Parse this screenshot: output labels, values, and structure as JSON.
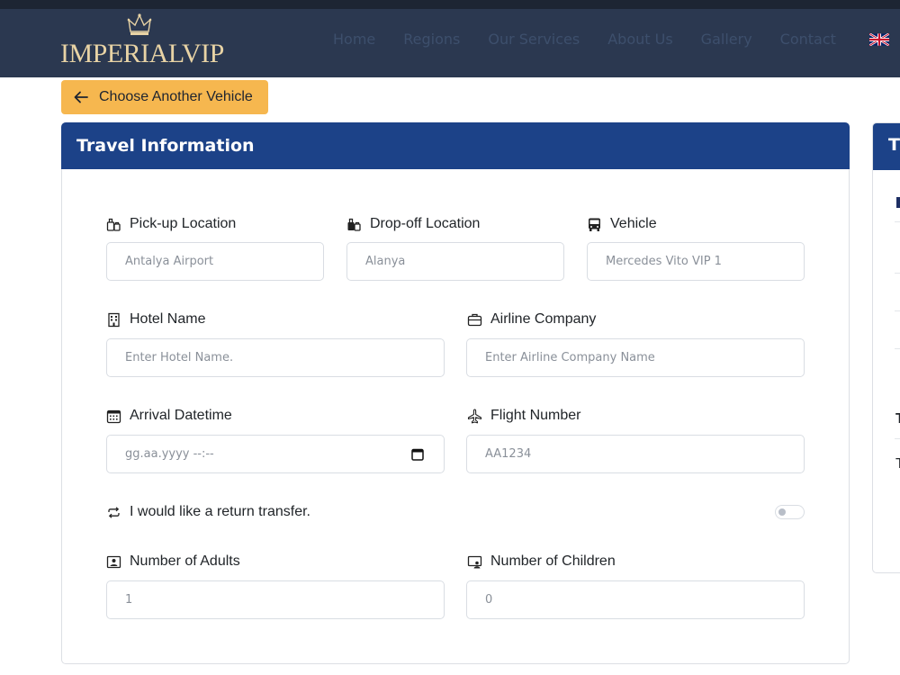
{
  "brand": {
    "name_part1": "IMPERIAL",
    "name_part2": "VIP"
  },
  "nav": {
    "items": [
      {
        "label": "Home"
      },
      {
        "label": "Regions"
      },
      {
        "label": "Our Services"
      },
      {
        "label": "About Us"
      },
      {
        "label": "Gallery"
      },
      {
        "label": "Contact"
      }
    ],
    "language_flag": "uk-flag-icon"
  },
  "back_button": {
    "label": "Choose Another Vehicle",
    "icon": "arrow-left-icon"
  },
  "travel_card": {
    "title": "Travel Information",
    "pickup": {
      "label": "Pick-up Location",
      "placeholder": "Antalya Airport",
      "icon": "luggage-icon"
    },
    "dropoff": {
      "label": "Drop-off Location",
      "placeholder": "Alanya",
      "icon": "luggage-icon"
    },
    "vehicle": {
      "label": "Vehicle",
      "placeholder": "Mercedes Vito VIP 1",
      "icon": "bus-icon"
    },
    "hotel": {
      "label": "Hotel Name",
      "placeholder": "Enter Hotel Name.",
      "icon": "building-icon"
    },
    "airline": {
      "label": "Airline Company",
      "placeholder": "Enter Airline Company Name",
      "icon": "briefcase-icon"
    },
    "arrival": {
      "label": "Arrival Datetime",
      "placeholder": "gg.aa.yyyy --:--",
      "icon": "calendar-icon"
    },
    "flight": {
      "label": "Flight Number",
      "placeholder": "AA1234",
      "icon": "airplane-icon"
    },
    "return_transfer": {
      "label": "I would like a return transfer.",
      "checked": false,
      "icon": "repeat-icon"
    },
    "adults": {
      "label": "Number of Adults",
      "value": "1",
      "icon": "person-badge-icon"
    },
    "children": {
      "label": "Number of Children",
      "value": "0",
      "icon": "person-screen-icon"
    }
  },
  "side_card": {
    "title_fragment": "T",
    "line1": "T",
    "line2": "T"
  },
  "colors": {
    "navbar": "#2b3850",
    "card_header": "#1c4288",
    "accent_button": "#f6b74f",
    "logo_gold": "#e8d3a5"
  }
}
